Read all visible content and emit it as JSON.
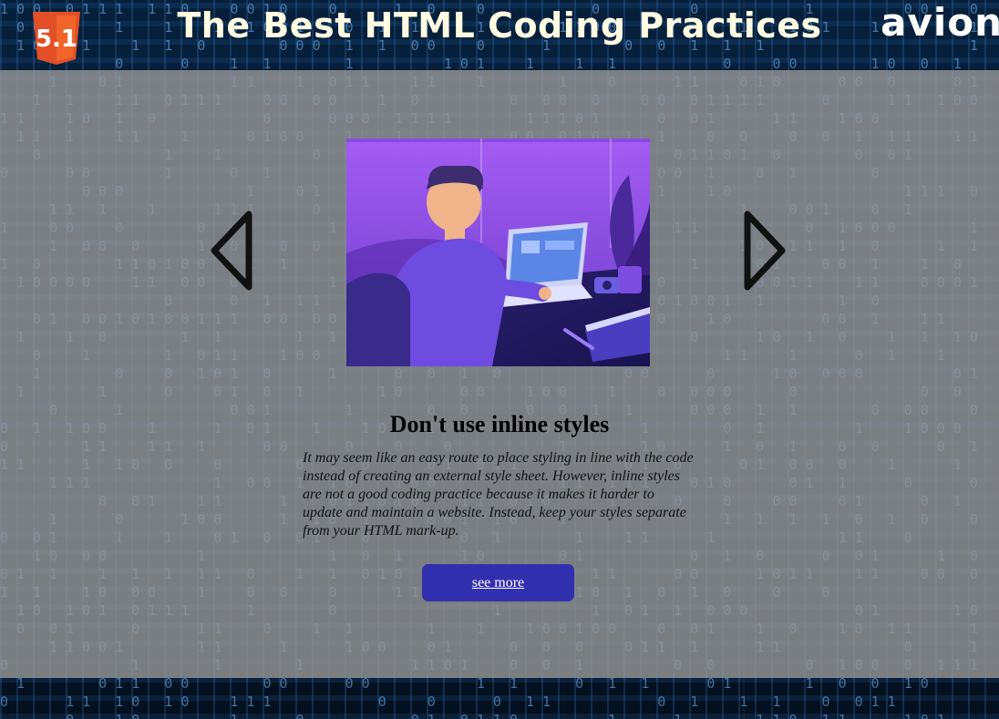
{
  "header": {
    "logo_icon": "html5-icon",
    "logo_badge": "5.1",
    "title": "The Best HTML Coding Practices",
    "brand": "avion"
  },
  "slider": {
    "prev_icon": "chevron-left-icon",
    "next_icon": "chevron-right-icon",
    "slide": {
      "title": "Don't use inline styles",
      "text": "It may seem like an easy route to place styling in line with the code instead of creating an external style sheet. However, inline styles are not a good coding practice because it makes it harder to update and maintain a website. Instead, keep your styles separate from your HTML mark-up.",
      "button_label": "see more"
    }
  },
  "colors": {
    "button": "#3330b0",
    "title": "#fffbe0",
    "overlay": "#969696"
  }
}
